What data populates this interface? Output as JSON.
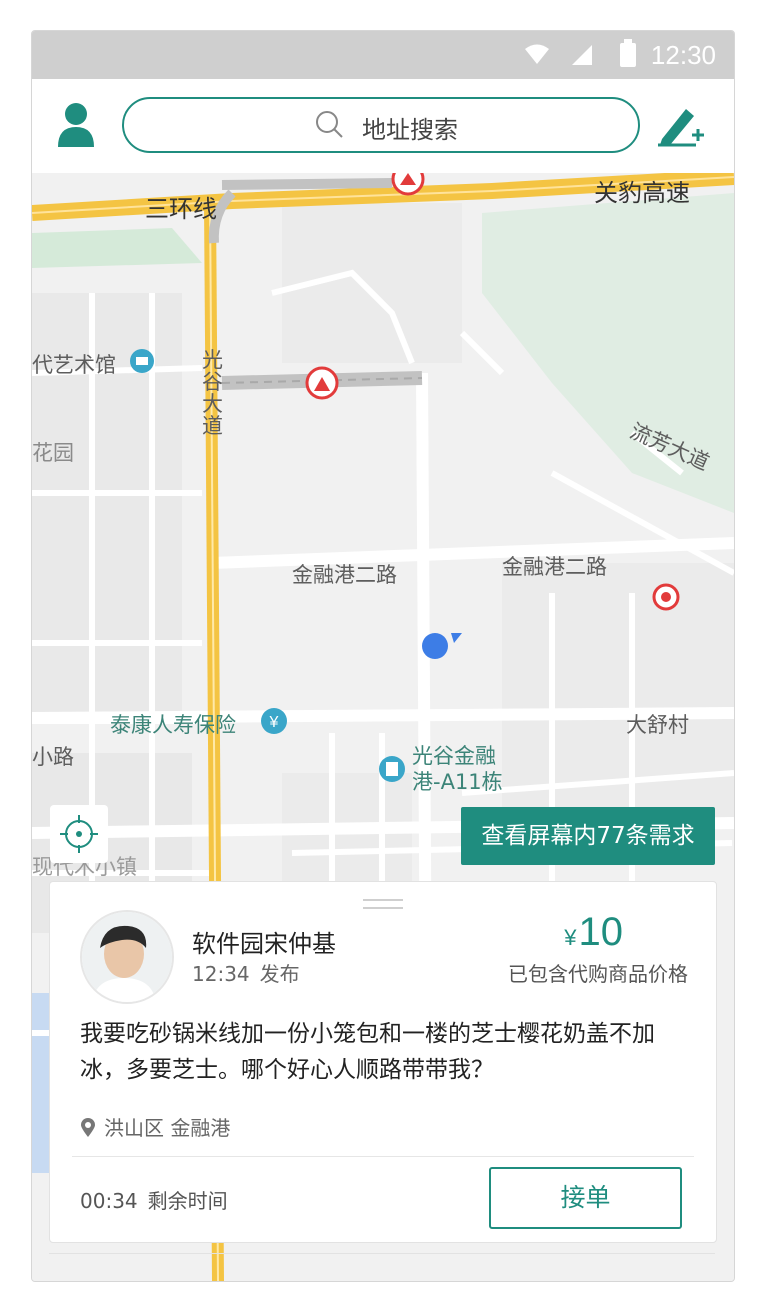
{
  "status_bar": {
    "time": "12:30"
  },
  "search": {
    "placeholder": "地址搜索"
  },
  "map": {
    "labels": {
      "ring_road": "三环线",
      "expressway": "关豹高速",
      "museum": "代艺术馆",
      "guanggu_ave": "光\n谷\n大\n道",
      "garden": "花园",
      "liufang_ave": "流芳大道",
      "jinrong_road_1": "金融港二路",
      "jinrong_road_2": "金融港二路",
      "taikang": "泰康人寿保险",
      "dashu": "大舒村",
      "small_road": "小路",
      "building_a11": "光谷金融\n港-A11栋",
      "town": "现代木小镇"
    },
    "view_requests_label": "查看屏幕内77条需求"
  },
  "order_card": {
    "user_name": "软件园宋仲基",
    "publish_time": "12:34",
    "publish_label": "发布",
    "currency": "¥",
    "price": "10",
    "price_note": "已包含代购商品价格",
    "description": "我要吃砂锅米线加一份小笼包和一楼的芝士樱花奶盖不加冰，多要芝士。哪个好心人顺路带带我？",
    "address": "洪山区 金融港",
    "remaining_time": "00:34",
    "remaining_label": "剩余时间",
    "accept_label": "接单"
  },
  "colors": {
    "accent": "#1f8d7f",
    "road_yellow": "#f4c443",
    "map_bg": "#f1f1f1"
  }
}
